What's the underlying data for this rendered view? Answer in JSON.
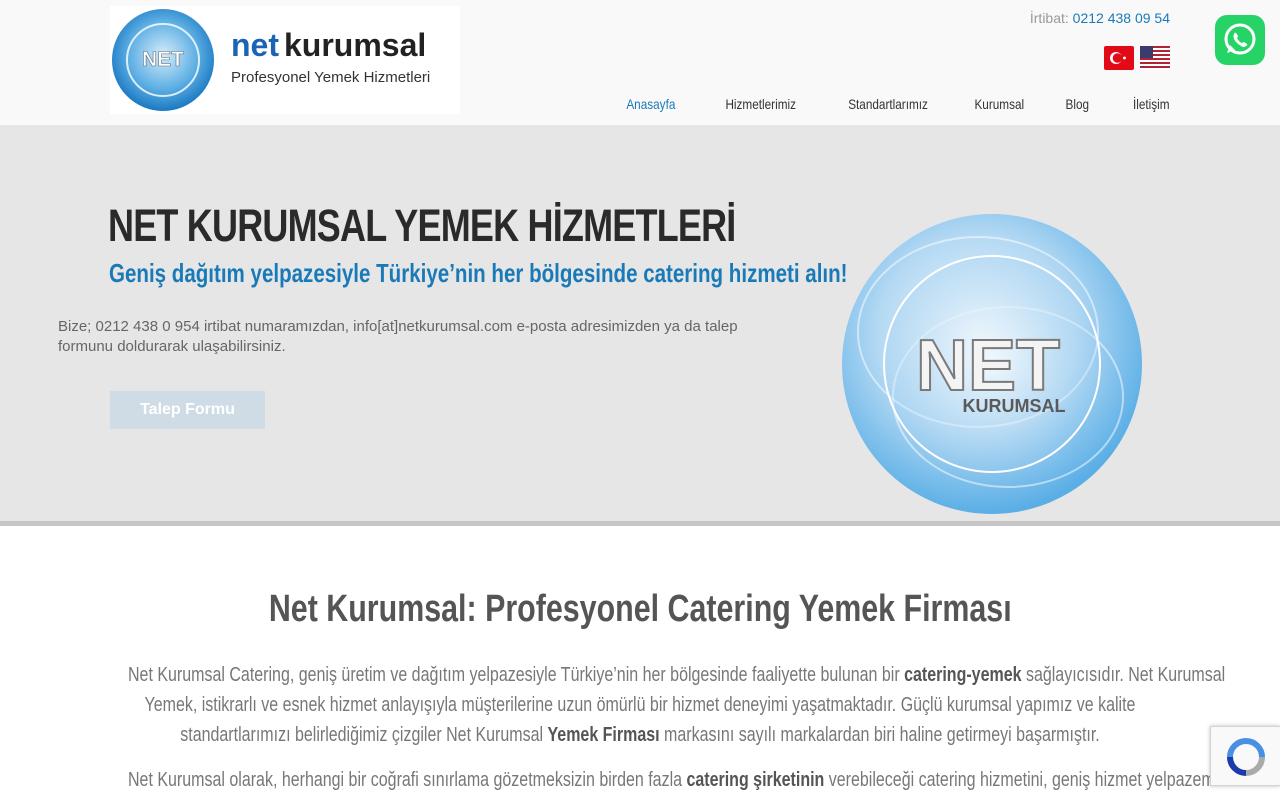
{
  "brand": {
    "logo_mark": "NET KURUMSAL",
    "name_part1": "net",
    "name_part2": "kurumsal",
    "tagline": "Profesyonel Yemek Hizmetleri"
  },
  "contact": {
    "label": "İrtibat:",
    "phone": "0212 438 09 54"
  },
  "languages": [
    {
      "icon": "turkey-flag-icon",
      "colors": [
        "#e30a17",
        "#ffffff"
      ]
    },
    {
      "icon": "usa-flag-icon",
      "colors": [
        "#b22234",
        "#ffffff",
        "#3c3b6e"
      ]
    }
  ],
  "nav": [
    {
      "label": "Anasayfa",
      "active": true
    },
    {
      "label": "Hizmetlerimiz",
      "active": false
    },
    {
      "label": "Standartlarımız",
      "active": false
    },
    {
      "label": "Kurumsal",
      "active": false
    },
    {
      "label": "Blog",
      "active": false
    },
    {
      "label": "İletişim",
      "active": false
    }
  ],
  "hero": {
    "title": "NET KURUMSAL YEMEK HİZMETLERİ",
    "subtitle": "Geniş dağıtım yelpazesiyle Türkiye’nin her bölgesinde catering hizmeti alın!",
    "text": "Bize; 0212 438 0 954 irtibat numaramızdan, info[at]netkurumsal.com e-posta adresimizden ya da talep formunu doldurarak ulaşabilirsiniz.",
    "button": "Talep Formu",
    "emblem_text1": "NET",
    "emblem_text2": "KURUMSAL"
  },
  "content": {
    "title": "Net Kurumsal: Profesyonel Catering Yemek Firması",
    "p1_line1_a": "Net Kurumsal Catering, geniş üretim ve dağıtım yelpazesiyle Türkiye’nin her bölgesinde faaliyette bulunan bir ",
    "p1_line1_b": "catering-yemek",
    "p1_line1_c": " sağlayıcısıdır. Net Kurumsal",
    "p1_line2": "Yemek, istikrarlı ve esnek hizmet anlayışıyla müşterilerine uzun ömürlü bir hizmet deneyimi yaşatmaktadır. Güçlü kurumsal yapımız ve kalite",
    "p1_line3_a": "standartlarımızı belirlediğimiz çizgiler Net Kurumsal ",
    "p1_line3_b": "Yemek Firması",
    "p1_line3_c": " markasını sayılı markalardan biri haline getirmeyi başarmıştır.",
    "p2_line1_a": "Net Kurumsal olarak, herhangi bir coğrafi sınırlama gözetmeksizin birden fazla ",
    "p2_line1_b": "catering şirketinin",
    "p2_line1_c": " verebileceği catering hizmetini, geniş hizmet yelpazemiz"
  },
  "widgets": {
    "whatsapp_icon": "whatsapp-icon",
    "recaptcha_icon": "recaptcha-icon"
  },
  "colors": {
    "accent": "#1a7ab8",
    "header_bg": "#f9f9f9",
    "hero_bg": "#e6e6e6",
    "whatsapp": "#25d366"
  }
}
